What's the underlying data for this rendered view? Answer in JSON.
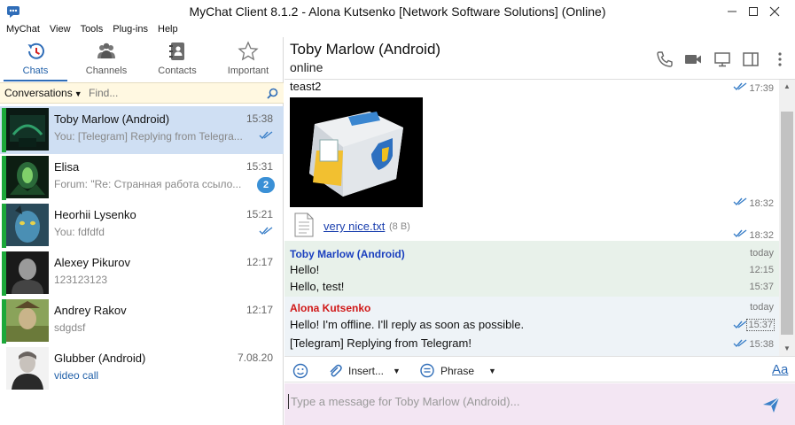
{
  "window": {
    "title": "MyChat Client 8.1.2 - Alona Kutsenko [Network Software Solutions] (Online)"
  },
  "menu": [
    "MyChat",
    "View",
    "Tools",
    "Plug-ins",
    "Help"
  ],
  "tabs": [
    {
      "label": "Chats",
      "icon": "history-icon",
      "active": true
    },
    {
      "label": "Channels",
      "icon": "people-icon",
      "active": false
    },
    {
      "label": "Contacts",
      "icon": "address-book-icon",
      "active": false
    },
    {
      "label": "Important",
      "icon": "star-icon",
      "active": false
    }
  ],
  "search": {
    "dropdown": "Conversations",
    "placeholder": "Find..."
  },
  "chats": [
    {
      "name": "Toby Marlow (Android)",
      "time": "15:38",
      "preview": "You: [Telegram] Replying from Telegra...",
      "status": "read",
      "selected": true
    },
    {
      "name": "Elisa",
      "time": "15:31",
      "preview": "Forum: \"Re: Странная работа ссыло...",
      "badge": "2"
    },
    {
      "name": "Heorhii Lysenko",
      "time": "15:21",
      "preview": "You: fdfdfd",
      "status": "read"
    },
    {
      "name": "Alexey Pikurov",
      "time": "12:17",
      "preview": "123123123"
    },
    {
      "name": "Andrey Rakov",
      "time": "12:17",
      "preview": "sdgdsf"
    },
    {
      "name": "Glubber (Android)",
      "time": "7.08.20",
      "preview": "video call"
    }
  ],
  "conversation": {
    "name": "Toby Marlow (Android)",
    "status": "online",
    "messages": {
      "first": {
        "text": "teast2",
        "time": "17:39"
      },
      "image_time": "18:32",
      "file": {
        "name": "very nice.txt",
        "size": "(8 B)",
        "time": "18:32"
      },
      "incoming": {
        "sender": "Toby Marlow (Android)",
        "day": "today",
        "lines": [
          {
            "text": "Hello!",
            "time": "12:15"
          },
          {
            "text": "Hello, test!",
            "time": "15:37"
          }
        ]
      },
      "outgoing": {
        "sender": "Alona Kutsenko",
        "day": "today",
        "lines": [
          {
            "text": "Hello! I'm offline. I'll reply as soon as possible.",
            "time": "15:37"
          },
          {
            "text": "[Telegram] Replying from Telegram!",
            "time": "15:38"
          }
        ]
      }
    }
  },
  "toolbar": {
    "insert_label": "Insert...",
    "phrase_label": "Phrase",
    "font_label": "Aa"
  },
  "compose": {
    "placeholder": "Type a message for Toby Marlow (Android)..."
  },
  "colors": {
    "accent": "#2f6db8",
    "online": "#1ca83a",
    "incoming_sender": "#1a3fbf",
    "outgoing_sender": "#d01818",
    "compose_bg": "#f3e6f3",
    "search_bg": "#fff8e1"
  }
}
